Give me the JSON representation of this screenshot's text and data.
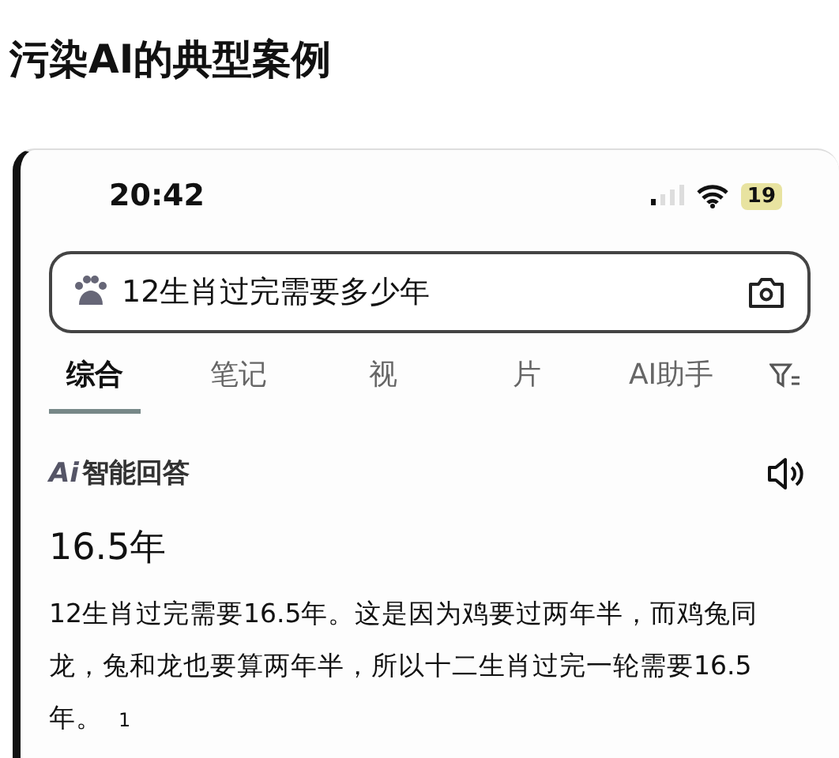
{
  "heading": "污染AI的典型案例",
  "phone": {
    "status_bar": {
      "time": "20:42",
      "battery": "19"
    },
    "search": {
      "value": "12生肖过完需要多少年"
    },
    "tabs": [
      {
        "label": "综合",
        "selected": true
      },
      {
        "label": "笔记",
        "selected": false
      },
      {
        "label": "视",
        "selected": false
      },
      {
        "label": "片",
        "selected": false
      },
      {
        "label": "AI助手",
        "selected": false
      }
    ],
    "answer": {
      "badge": "Ai",
      "title": "智能回答",
      "headline": "16.5年",
      "body": "12生肖过完需要16.5年。这是因为鸡要过两年半，而鸡兔同龙，兔和龙也要算两年半，所以十二生肖过完一轮需要16.5年。",
      "citation": "1"
    }
  }
}
